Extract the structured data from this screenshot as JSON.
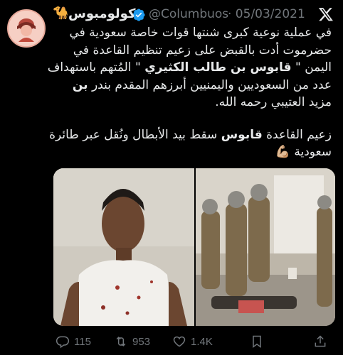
{
  "tweet": {
    "display_name": "كولومبوس",
    "handle": "@Columbuos",
    "separator_date": "· 05/03/2021",
    "paragraph1": {
      "line1": "في عملية نوعية كبرى شنتها قوات خاصة سعودية في",
      "line2": "حضرموت أدت بالقبض على زعيم تنظيم القاعدة في",
      "line3_prefix": "اليمن \"",
      "line3_bold": "قابوس بن طالب الكثيري",
      "line3_suffix": "\" المُتهم باستهداف",
      "line4_prefix": "عدد من السعوديين واليمنيين أبرزهم المقدم بندر",
      "line4_bold": "بن",
      "line5": "مزيد العتيبي رحمه الله."
    },
    "paragraph2": {
      "line1_prefix": "زعيم القاعدة",
      "line1_bold": "قابوس",
      "line1_suffix": "سقط بيد الأبطال ونُقل عبر طائرة",
      "line2": "سعودية",
      "emoji": "💪🏼"
    }
  },
  "actions": {
    "reply_count": "115",
    "retweet_count": "953",
    "like_count": "1.4K"
  },
  "icons": {
    "brand": "x-logo-icon",
    "verified": "verified-badge-icon",
    "camel": "camel-emoji-icon",
    "reply": "reply-icon",
    "retweet": "retweet-icon",
    "like": "heart-icon",
    "bookmark": "bookmark-icon",
    "share": "share-icon"
  },
  "colors": {
    "background": "#000000",
    "text": "#e7e9ea",
    "muted": "#71767b",
    "verified": "#1d9bf0"
  }
}
